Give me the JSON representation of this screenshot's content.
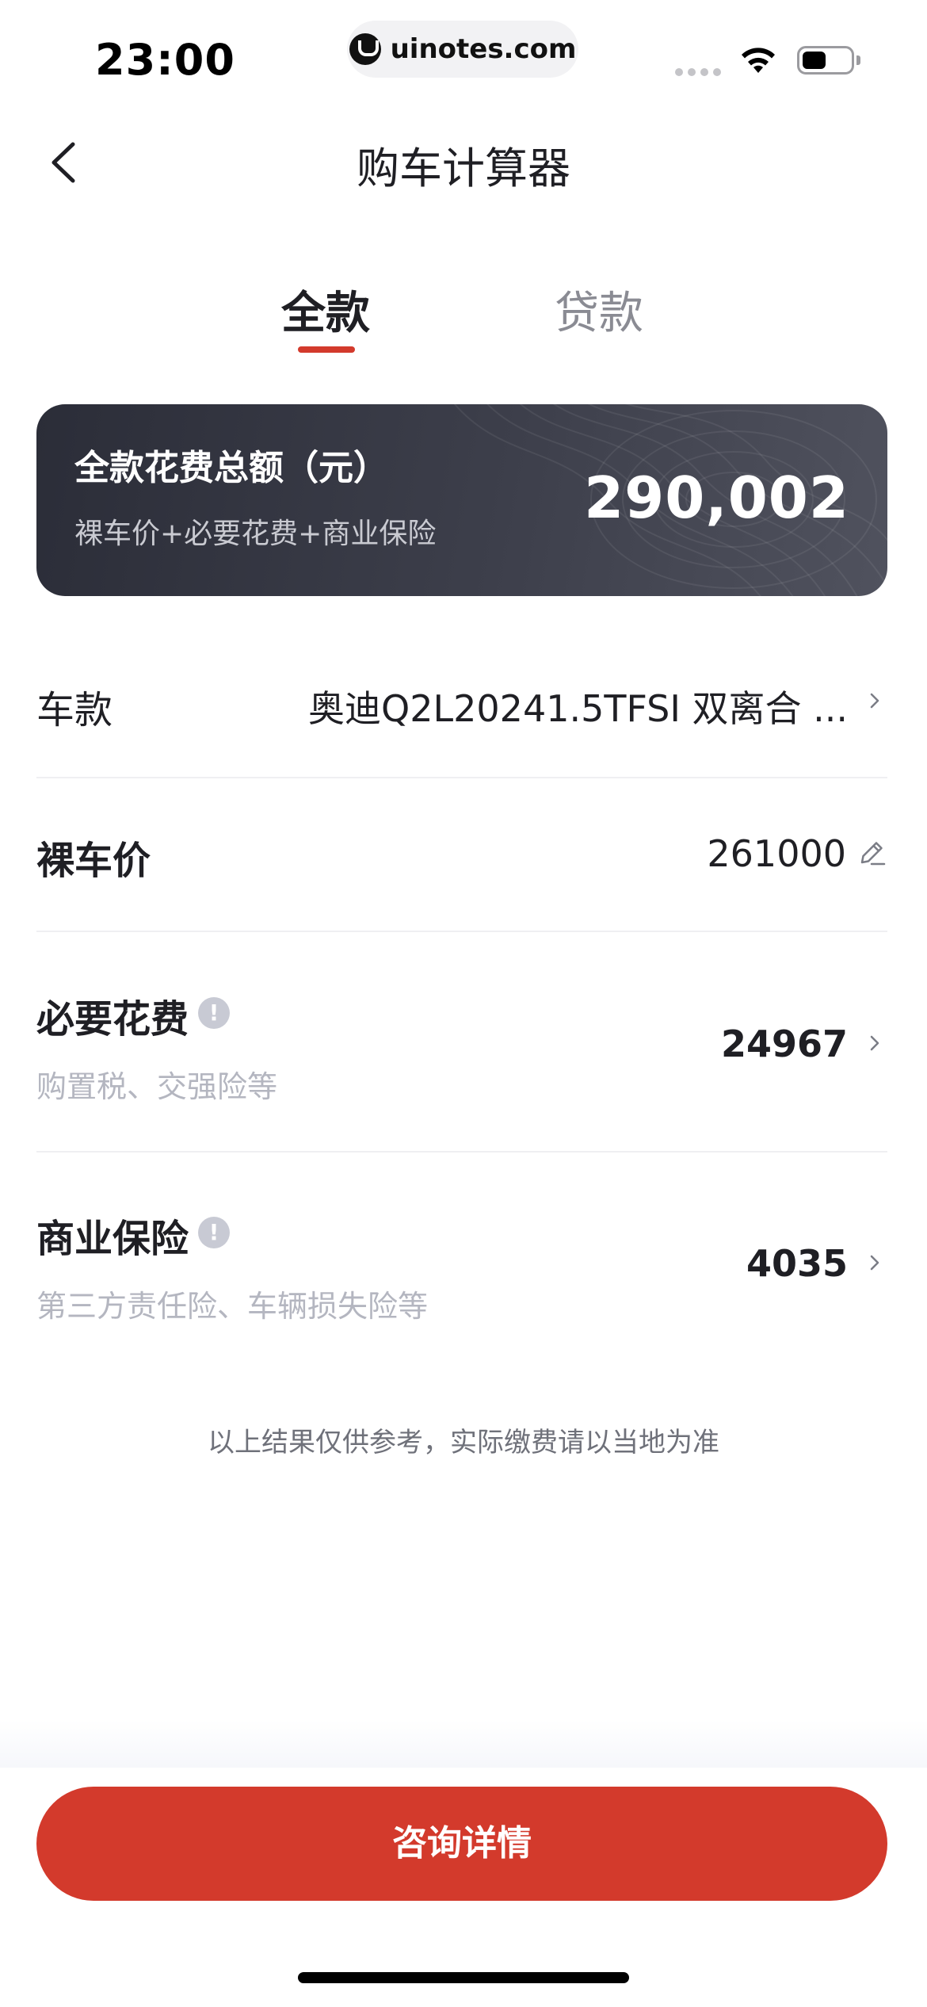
{
  "status_bar": {
    "time": "23:00",
    "url": "uinotes.com",
    "battery_level": 0.5
  },
  "nav": {
    "title": "购车计算器",
    "back_icon": "chevron-left-icon"
  },
  "tabs": [
    {
      "label": "全款",
      "active": true
    },
    {
      "label": "贷款",
      "active": false
    }
  ],
  "summary": {
    "title": "全款花费总额（元）",
    "subtitle": "裸车价+必要花费+商业保险",
    "total": "290,002"
  },
  "rows": {
    "model": {
      "label": "车款",
      "value": "奥迪Q2L20241.5TFSI 双离合 ..."
    },
    "bare_price": {
      "label": "裸车价",
      "value": "261000"
    },
    "necessary": {
      "label": "必要花费",
      "hint": "购置税、交强险等",
      "value": "24967",
      "info_icon_glyph": "!"
    },
    "insurance": {
      "label": "商业保险",
      "hint": "第三方责任险、车辆损失险等",
      "value": "4035",
      "info_icon_glyph": "!"
    }
  },
  "disclaimer": "以上结果仅供参考，实际缴费请以当地为准",
  "cta": {
    "label": "咨询详情"
  },
  "colors": {
    "accent": "#d33a2c",
    "card_dark": "#2b2d38",
    "text_primary": "#1f1f24",
    "text_hint": "#b4b6c0"
  }
}
